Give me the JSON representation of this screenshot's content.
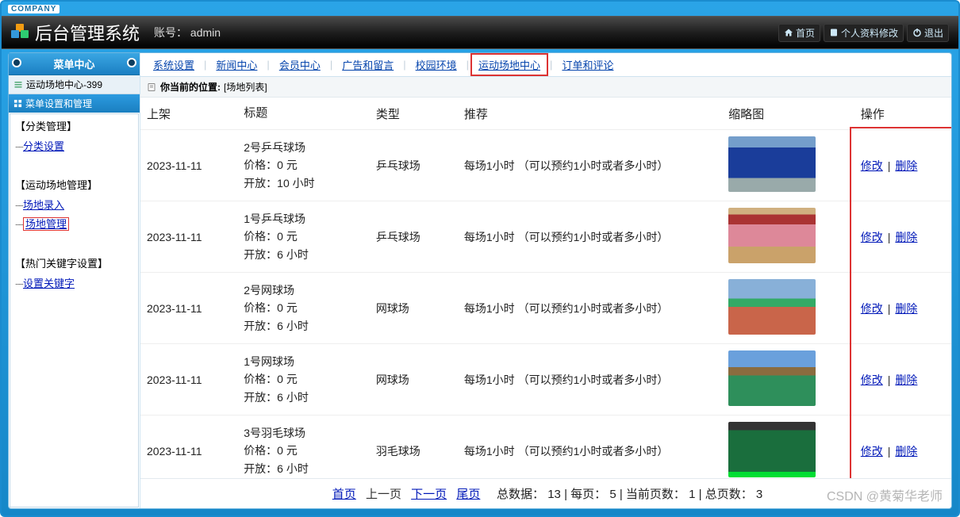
{
  "chrome": {
    "company_label": "COMPANY",
    "app_title": "后台管理系统",
    "account_label": "账号：",
    "account_value": "admin",
    "home": "首页",
    "profile": "个人资料修改",
    "logout": "退出"
  },
  "sidebar": {
    "header": "菜单中心",
    "crumb": "运动场地中心-399",
    "section_title": "菜单设置和管理",
    "groups": [
      {
        "heading": "【分类管理】",
        "items": [
          {
            "label": "分类设置",
            "boxed": false
          }
        ]
      },
      {
        "heading": "【运动场地管理】",
        "items": [
          {
            "label": "场地录入",
            "boxed": false
          },
          {
            "label": "场地管理",
            "boxed": true
          }
        ]
      },
      {
        "heading": "【热门关键字设置】",
        "items": [
          {
            "label": "设置关键字",
            "boxed": false
          }
        ]
      }
    ]
  },
  "nav": {
    "items": [
      {
        "label": "系统设置",
        "active": false
      },
      {
        "label": "新闻中心",
        "active": false
      },
      {
        "label": "会员中心",
        "active": false
      },
      {
        "label": "广告和留言",
        "active": false
      },
      {
        "label": "校园环境",
        "active": false
      },
      {
        "label": "运动场地中心",
        "active": true
      },
      {
        "label": "订单和评论",
        "active": false
      }
    ]
  },
  "breadcrumb": {
    "label": "你当前的位置:",
    "value": "[场地列表]"
  },
  "table": {
    "headers": {
      "date": "上架",
      "title": "标题",
      "type": "类型",
      "rec": "推荐",
      "thumb": "缩略图",
      "ops": "操作"
    },
    "title_price_prefix": "价格：",
    "title_price_suffix": " 元",
    "title_open_prefix": "开放：",
    "title_open_suffix": " 小时",
    "rec_rule": "每场1小时",
    "rec_note": "（可以预约1小时或者多小时）",
    "op_edit": "修改",
    "op_delete": "删除",
    "rows": [
      {
        "date": "2023-11-11",
        "name": "2号乒乓球场",
        "price": "0",
        "open": "10",
        "type": "乒乓球场",
        "thumb_class": "t1"
      },
      {
        "date": "2023-11-11",
        "name": "1号乒乓球场",
        "price": "0",
        "open": "6",
        "type": "乒乓球场",
        "thumb_class": "t2"
      },
      {
        "date": "2023-11-11",
        "name": "2号网球场",
        "price": "0",
        "open": "6",
        "type": "网球场",
        "thumb_class": "t3"
      },
      {
        "date": "2023-11-11",
        "name": "1号网球场",
        "price": "0",
        "open": "6",
        "type": "网球场",
        "thumb_class": "t4"
      },
      {
        "date": "2023-11-11",
        "name": "3号羽毛球场",
        "price": "0",
        "open": "6",
        "type": "羽毛球场",
        "thumb_class": "t5"
      }
    ]
  },
  "pager": {
    "first": "首页",
    "prev": "上一页",
    "next": "下一页",
    "last": "尾页",
    "total_label": "总数据：",
    "total_value": "13",
    "per_label": "每页：",
    "per_value": "5",
    "cur_label": "当前页数：",
    "cur_value": "1",
    "pages_label": "总页数：",
    "pages_value": "3"
  },
  "watermark": "CSDN @黄菊华老师"
}
